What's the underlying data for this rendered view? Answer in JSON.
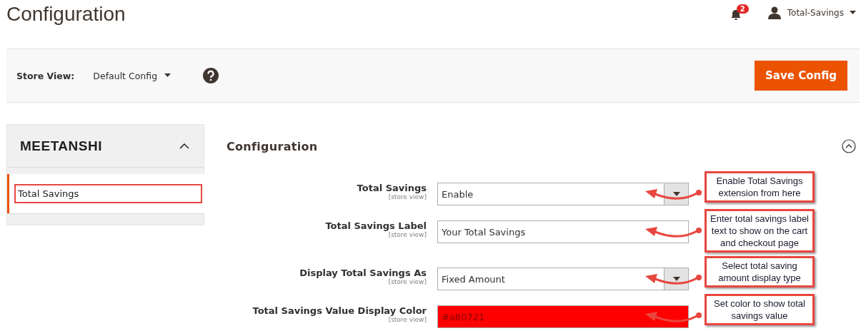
{
  "page_title": "Configuration",
  "header": {
    "notifications": "2",
    "user": "Total-Savings"
  },
  "toolbar": {
    "store_view_label": "Store View:",
    "store_view": "Default Config",
    "save_button": "Save Config"
  },
  "sidebar": {
    "logo": "MEETANSHI",
    "expanded": true,
    "items": [
      {
        "label": "Total Savings",
        "selected": true
      }
    ]
  },
  "section": {
    "title": "Configuration",
    "expanded": true,
    "fields": [
      {
        "kind": "select",
        "label": "Total Savings",
        "scope": "[store view]",
        "value": "Enable",
        "callout": "Enable Total Savings extension from here"
      },
      {
        "kind": "text",
        "label": "Total Savings Label",
        "scope": "[store view]",
        "value": "Your Total Savings",
        "callout": "Enter total savings label text to show on the cart and checkout page"
      },
      {
        "kind": "select",
        "label": "Display Total Savings As",
        "scope": "[store view]",
        "value": "Fixed Amount",
        "callout": "Select total saving amount display type"
      },
      {
        "kind": "color",
        "label": "Total Savings Value Display Color",
        "scope": "[store view]",
        "value": "#a80721",
        "color": "#ff0000",
        "callout": "Set color to show total savings value"
      }
    ]
  }
}
